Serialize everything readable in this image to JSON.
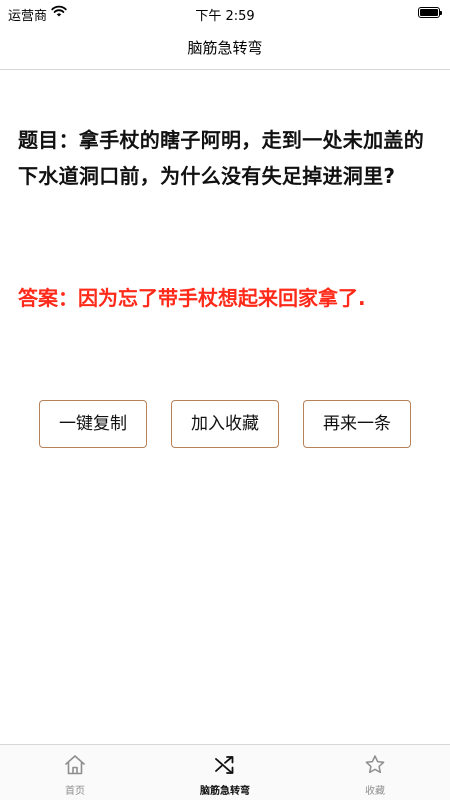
{
  "status_bar": {
    "carrier": "运营商",
    "time": "下午 2:59",
    "wifi_icon": "wifi-icon",
    "battery_icon": "battery-icon",
    "battery_level": 1.0
  },
  "nav": {
    "title": "脑筋急转弯"
  },
  "content": {
    "question": "题目：拿手杖的瞎子阿明，走到一处未加盖的下水道洞口前，为什么没有失足掉进洞里?",
    "answer": "答案：因为忘了带手杖想起来回家拿了.",
    "answer_color": "#ff2a1a"
  },
  "actions": {
    "copy_label": "一键复制",
    "favorite_label": "加入收藏",
    "next_label": "再来一条",
    "border_color": "#b7825a"
  },
  "tab_bar": {
    "items": [
      {
        "label": "首页",
        "icon": "home-icon",
        "active": false
      },
      {
        "label": "脑筋急转弯",
        "icon": "shuffle-icon",
        "active": true
      },
      {
        "label": "收藏",
        "icon": "star-icon",
        "active": false
      }
    ]
  }
}
